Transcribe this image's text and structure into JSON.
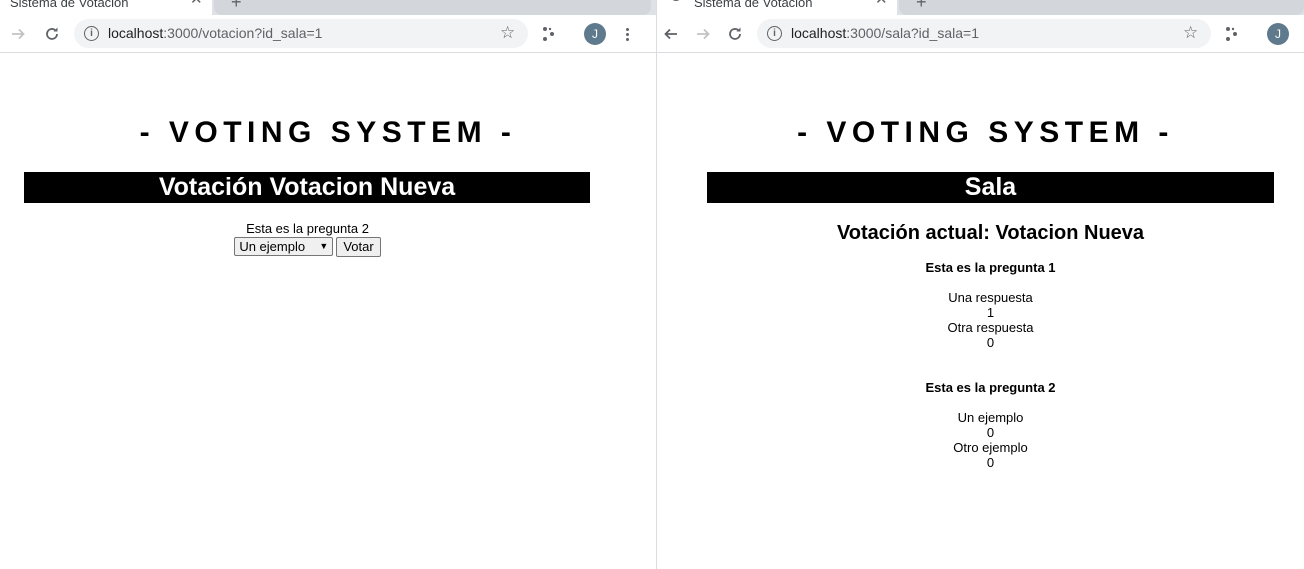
{
  "left": {
    "tab": {
      "title": "Sistema de Votación"
    },
    "newtab_icon": "plus-icon",
    "url": {
      "host": "localhost",
      "path": ":3000/votacion?id_sala=1"
    },
    "avatar_letter": "J",
    "app_title": "- VOTING SYSTEM -",
    "header": "Votación Votacion Nueva",
    "form": {
      "question": "Esta es la pregunta 2",
      "selected_option": "Un ejemplo",
      "submit_label": "Votar"
    }
  },
  "right": {
    "tab": {
      "title": "Sistema de Votación"
    },
    "url": {
      "host": "localhost",
      "path": ":3000/sala?id_sala=1"
    },
    "avatar_letter": "J",
    "app_title": "- VOTING SYSTEM -",
    "header": "Sala",
    "current_vote": "Votación actual: Votacion Nueva",
    "questions": [
      {
        "title": "Esta es la pregunta 1",
        "answers": [
          {
            "text": "Una respuesta",
            "count": "1"
          },
          {
            "text": "Otra respuesta",
            "count": "0"
          }
        ]
      },
      {
        "title": "Esta es la pregunta 2",
        "answers": [
          {
            "text": "Un ejemplo",
            "count": "0"
          },
          {
            "text": "Otro ejemplo",
            "count": "0"
          }
        ]
      }
    ]
  },
  "colors": {
    "bar_bg": "#000000",
    "bar_text": "#ffffff",
    "avatar": "#5f7a8c"
  }
}
